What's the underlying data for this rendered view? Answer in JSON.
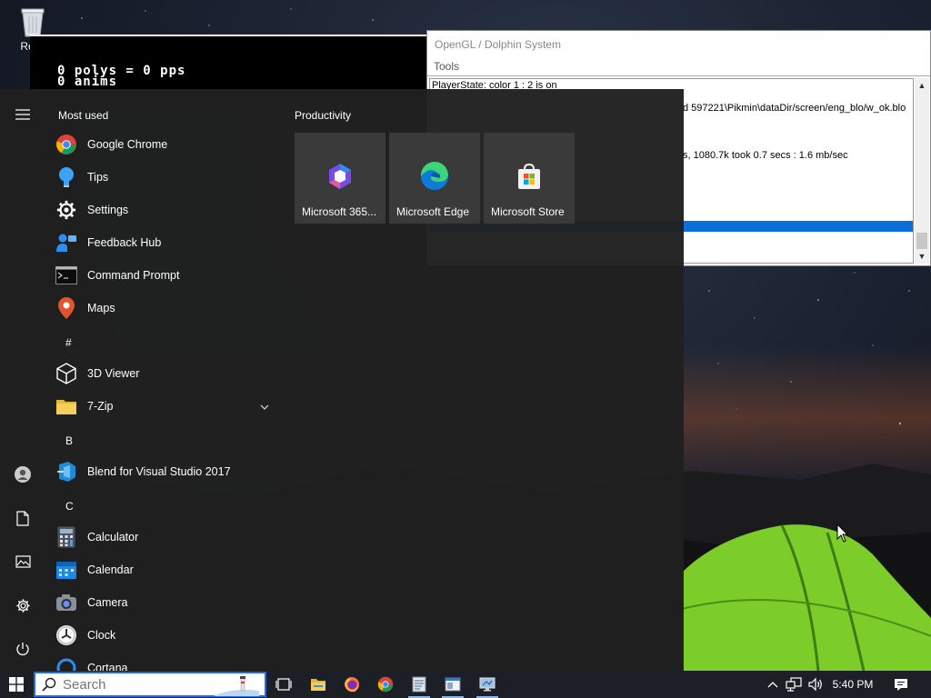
{
  "desktop": {
    "recycle_bin_label": "Recy"
  },
  "emulator_window": {
    "line1": "0 polys = 0 pps",
    "line2": "0 anims"
  },
  "dolphin_window": {
    "title": "OpenGL / Dolphin System",
    "menu": "Tools",
    "log": [
      "PlayerState: color 1 : 2 is on",
      "d 597221\\Pikmin\\dataDir/screen/eng_blo/w_ok.blo",
      "s, 1080.7k took 0.7 secs : 1.6 mb/sec"
    ]
  },
  "start_menu": {
    "most_used_label": "Most used",
    "most_used": [
      {
        "name": "Google Chrome",
        "icon": "chrome-icon"
      },
      {
        "name": "Tips",
        "icon": "lightbulb-icon"
      },
      {
        "name": "Settings",
        "icon": "gear-icon"
      },
      {
        "name": "Feedback Hub",
        "icon": "feedback-hub-icon"
      },
      {
        "name": "Command Prompt",
        "icon": "terminal-icon"
      },
      {
        "name": "Maps",
        "icon": "map-pin-icon"
      }
    ],
    "groups": [
      {
        "letter": "#",
        "apps": [
          {
            "name": "3D Viewer",
            "icon": "cube-icon"
          },
          {
            "name": "7-Zip",
            "icon": "folder-icon"
          }
        ]
      },
      {
        "letter": "B",
        "apps": [
          {
            "name": "Blend for Visual Studio 2017",
            "icon": "blend-icon"
          }
        ]
      },
      {
        "letter": "C",
        "apps": [
          {
            "name": "Calculator",
            "icon": "calculator-icon"
          },
          {
            "name": "Calendar",
            "icon": "calendar-icon"
          },
          {
            "name": "Camera",
            "icon": "camera-icon"
          },
          {
            "name": "Clock",
            "icon": "clock-icon"
          },
          {
            "name": "Cortana",
            "icon": "cortana-icon"
          }
        ]
      }
    ],
    "tiles_group": "Productivity",
    "tiles": [
      {
        "label": "Microsoft 365...",
        "icon": "microsoft-365-icon"
      },
      {
        "label": "Microsoft Edge",
        "icon": "edge-icon"
      },
      {
        "label": "Microsoft Store",
        "icon": "store-icon"
      }
    ]
  },
  "taskbar": {
    "search_placeholder": "Search",
    "clock": "5:40 PM"
  }
}
